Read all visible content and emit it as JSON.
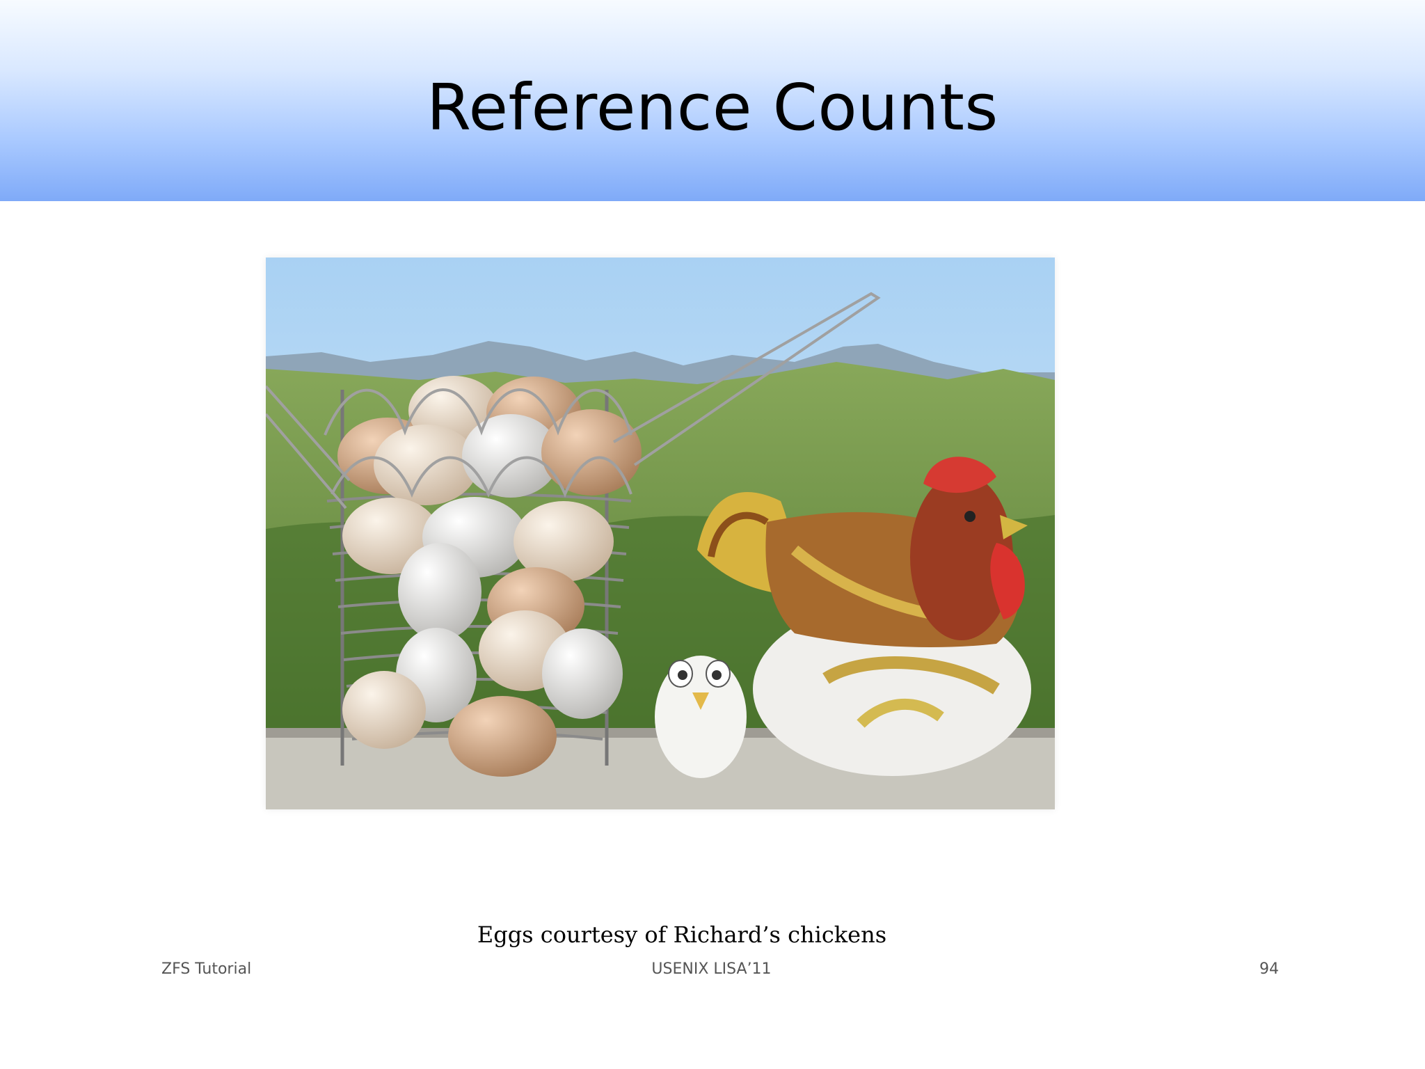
{
  "slide": {
    "title": "Reference Counts",
    "caption": "Eggs courtesy of Richard’s chickens",
    "footer": {
      "left": "ZFS Tutorial",
      "center": "USENIX LISA’11",
      "right": "94"
    }
  },
  "colors": {
    "header_top": "#f7fbff",
    "header_bottom": "#7faaf8",
    "text": "#000000",
    "footer_text": "#555555"
  }
}
